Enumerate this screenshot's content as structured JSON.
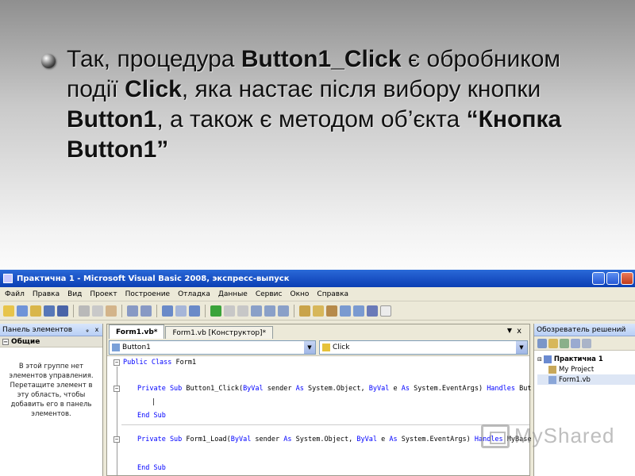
{
  "slide": {
    "text_1": "Так, процедура ",
    "b1": "Button1_Click",
    "text_2": " є обробником події ",
    "b2": "Click",
    "text_3": ", яка настає після вибору кнопки ",
    "b3": "Button1",
    "text_4": ", а також є методом об’єкта ",
    "b4": "“Кнопка Button1”"
  },
  "window": {
    "title": "Практична 1 - Microsoft Visual Basic 2008, экспресс-выпуск"
  },
  "menu": [
    "Файл",
    "Правка",
    "Вид",
    "Проект",
    "Построение",
    "Отладка",
    "Данные",
    "Сервис",
    "Окно",
    "Справка"
  ],
  "toolbox": {
    "title": "Панель элементов",
    "pin": "ᵩ",
    "close": "x",
    "group": "Общие",
    "message": "В этой группе нет элементов управления. Перетащите элемент в эту область, чтобы добавить его в панель элементов."
  },
  "editor": {
    "tabs": [
      {
        "label": "Form1.vb*",
        "active": true
      },
      {
        "label": "Form1.vb [Конструктор]*",
        "active": false
      }
    ],
    "tab_arrow": "▼",
    "tab_close": "x",
    "object_combo": "Button1",
    "event_combo": "Click",
    "code": [
      {
        "kw": "Public Class",
        "rest": " Form1"
      },
      {
        "kw": "Private Sub",
        "rest": " Button1_Click(",
        "kw2": "ByVal",
        "rest2": " sender ",
        "kw3": "As",
        "rest3": " System.Object, ",
        "kw4": "ByVal",
        "rest4": " e ",
        "kw5": "As",
        "rest5": " System.EventArgs) ",
        "kw6": "Handles",
        "rest6": " But"
      },
      {
        "kw": "End Sub",
        "rest": ""
      },
      {
        "kw": "Private Sub",
        "rest": " Form1_Load(",
        "kw2": "ByVal",
        "rest2": " sender ",
        "kw3": "As",
        "rest3": " System.Object, ",
        "kw4": "ByVal",
        "rest4": " e ",
        "kw5": "As",
        "rest5": " System.EventArgs) ",
        "kw6": "Handles",
        "rest6": " MyBase"
      },
      {
        "kw": "End Sub",
        "rest": ""
      }
    ]
  },
  "solution": {
    "title": "Обозреватель решений",
    "items": [
      "Практична 1",
      "My Project",
      "Form1.vb"
    ]
  },
  "watermark": "MyShared",
  "colors": {
    "titlebar": "#1e57c9",
    "keyword": "#0000ff",
    "chrome": "#ece9d8"
  }
}
